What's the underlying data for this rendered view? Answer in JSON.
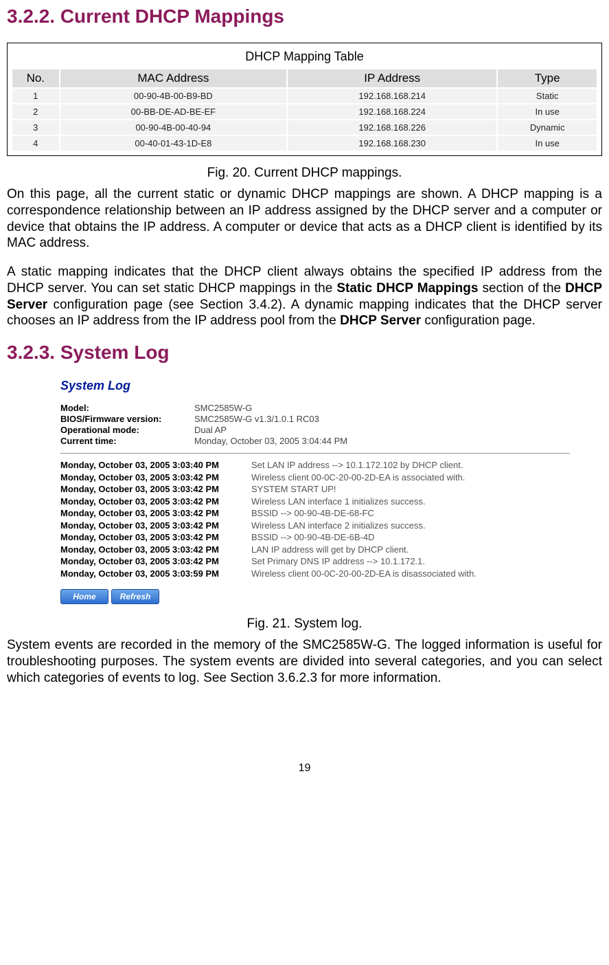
{
  "section1": {
    "heading": "3.2.2. Current DHCP Mappings",
    "table_title": "DHCP Mapping Table",
    "headers": {
      "no": "No.",
      "mac": "MAC Address",
      "ip": "IP Address",
      "type": "Type"
    },
    "rows": [
      {
        "no": "1",
        "mac": "00-90-4B-00-B9-BD",
        "ip": "192.168.168.214",
        "type": "Static"
      },
      {
        "no": "2",
        "mac": "00-BB-DE-AD-BE-EF",
        "ip": "192.168.168.224",
        "type": "In use"
      },
      {
        "no": "3",
        "mac": "00-90-4B-00-40-94",
        "ip": "192.168.168.226",
        "type": "Dynamic"
      },
      {
        "no": "4",
        "mac": "00-40-01-43-1D-E8",
        "ip": "192.168.168.230",
        "type": "In use"
      }
    ],
    "caption": "Fig. 20. Current DHCP mappings.",
    "para1": "On this page, all the current static or dynamic DHCP mappings are shown. A DHCP map­ping is a correspondence relationship between an IP address assigned by the DHCP server and a computer or device that obtains the IP address. A computer or device that acts as a DHCP client is identified by its MAC address.",
    "para2_a": "A static mapping indicates that the DHCP client always obtains the specified IP address from the DHCP server. You can set static DHCP mappings in the ",
    "para2_b": "Static DHCP Mappings",
    "para2_c": " section of the ",
    "para2_d": "DHCP Server",
    "para2_e": " configuration page (see Section 3.4.2). A dynamic mapping indicates that the DHCP server chooses an IP address from the IP address pool from the ",
    "para2_f": "DHCP Server",
    "para2_g": " configuration page."
  },
  "section2": {
    "heading": "3.2.3. System Log",
    "panel_title": "System Log",
    "info": [
      {
        "label": "Model:",
        "value": "SMC2585W-G"
      },
      {
        "label": "BIOS/Firmware version:",
        "value": "SMC2585W-G v1.3/1.0.1 RC03"
      },
      {
        "label": "Operational mode:",
        "value": "Dual AP"
      },
      {
        "label": "Current time:",
        "value": "Monday, October 03, 2005 3:04:44 PM"
      }
    ],
    "logs": [
      {
        "time": "Monday, October 03, 2005 3:03:40 PM",
        "msg": "Set LAN IP address --> 10.1.172.102 by DHCP client."
      },
      {
        "time": "Monday, October 03, 2005 3:03:42 PM",
        "msg": "Wireless client 00-0C-20-00-2D-EA is associated with."
      },
      {
        "time": "Monday, October 03, 2005 3:03:42 PM",
        "msg": "SYSTEM START UP!"
      },
      {
        "time": "Monday, October 03, 2005 3:03:42 PM",
        "msg": "Wireless LAN interface 1 initializes success."
      },
      {
        "time": "Monday, October 03, 2005 3:03:42 PM",
        "msg": "BSSID --> 00-90-4B-DE-68-FC"
      },
      {
        "time": "Monday, October 03, 2005 3:03:42 PM",
        "msg": "Wireless LAN interface 2 initializes success."
      },
      {
        "time": "Monday, October 03, 2005 3:03:42 PM",
        "msg": "BSSID --> 00-90-4B-DE-6B-4D"
      },
      {
        "time": "Monday, October 03, 2005 3:03:42 PM",
        "msg": "LAN IP address will get by DHCP client."
      },
      {
        "time": "Monday, October 03, 2005 3:03:42 PM",
        "msg": "Set Primary DNS IP address --> 10.1.172.1."
      },
      {
        "time": "Monday, October 03, 2005 3:03:59 PM",
        "msg": "Wireless client 00-0C-20-00-2D-EA is disassociated with."
      }
    ],
    "buttons": {
      "home": "Home",
      "refresh": "Refresh"
    },
    "caption": "Fig. 21. System log.",
    "para": "System events are recorded in the memory of the SMC2585W-G. The logged information is useful for troubleshooting purposes. The system events are divided into several categories, and you can select which categories of events to log. See Section 3.6.2.3 for more informa­tion."
  },
  "page_number": "19"
}
